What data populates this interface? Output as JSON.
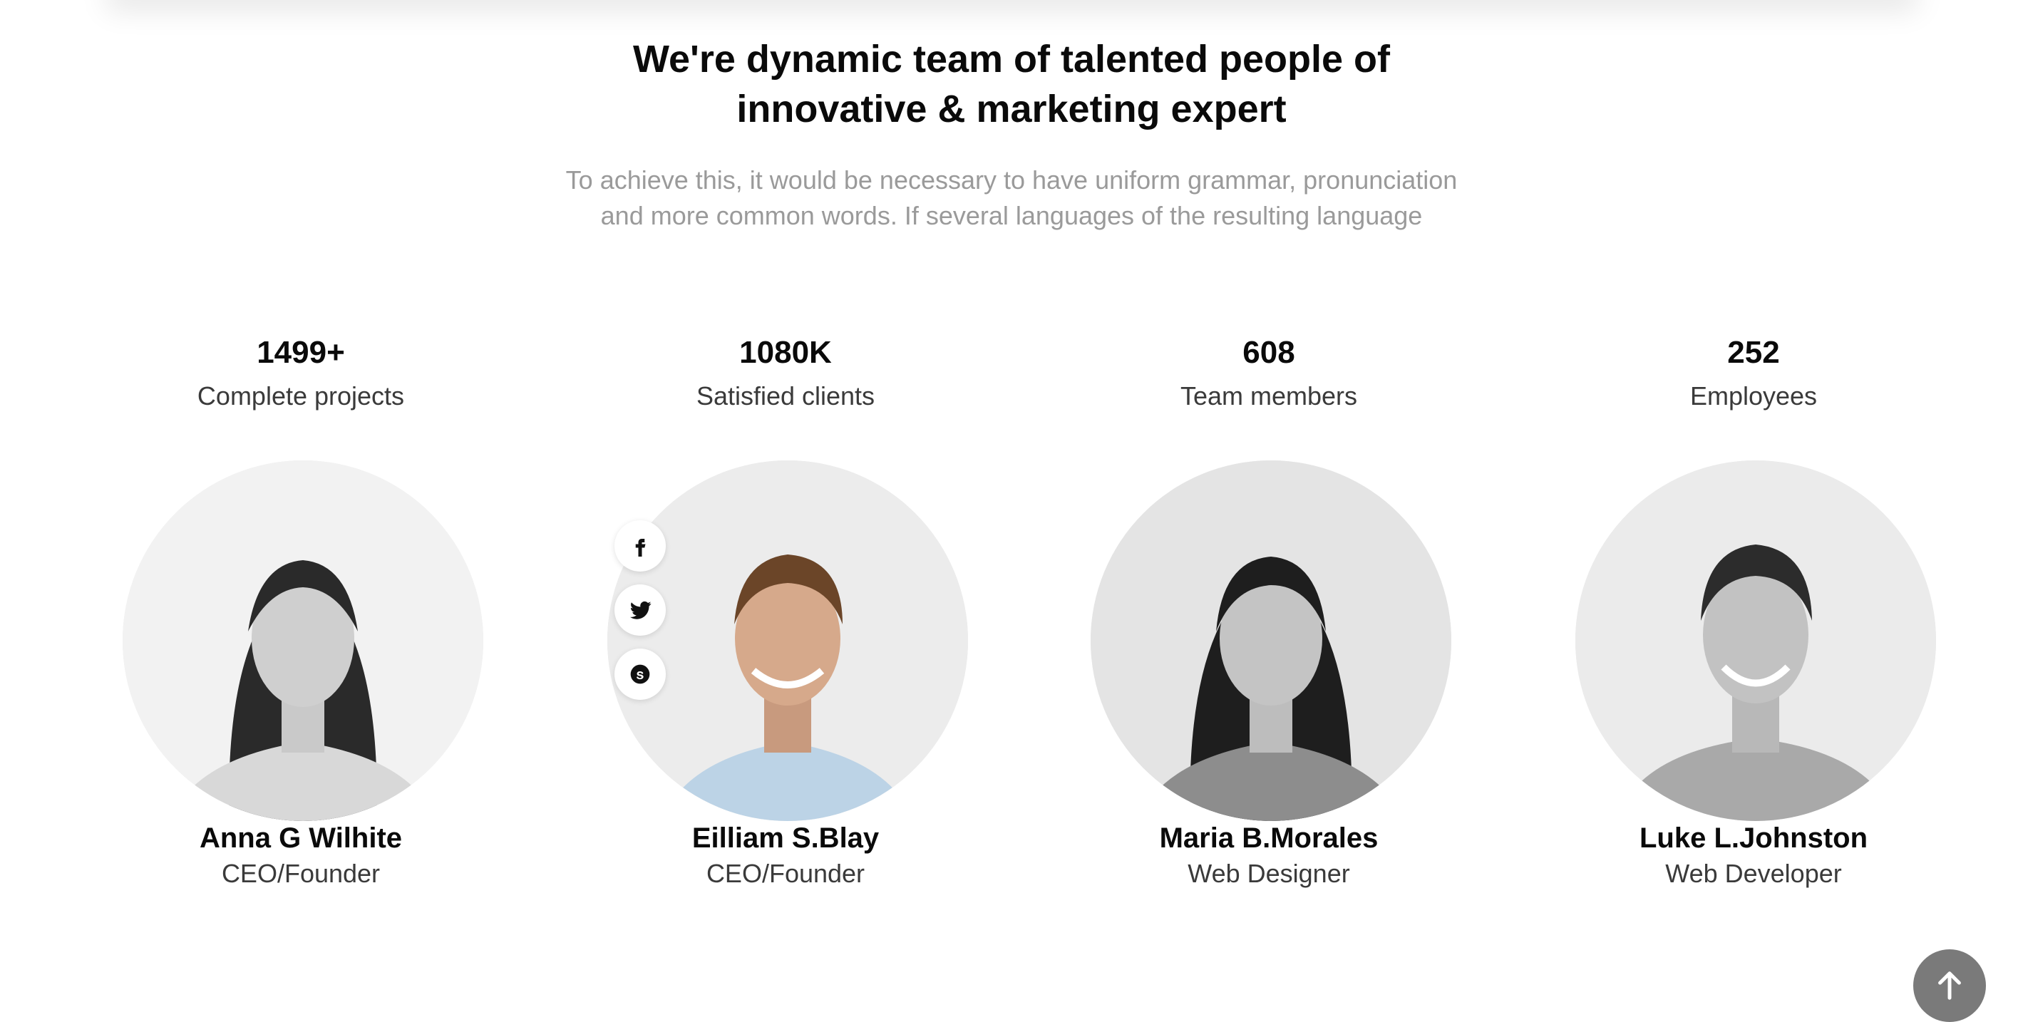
{
  "section": {
    "heading_line1": "We're dynamic team of talented people of",
    "heading_line2": "innovative & marketing expert",
    "subtext_line1": "To achieve this, it would be necessary to have uniform grammar, pronunciation",
    "subtext_line2": "and more common words. If several languages of the resulting language"
  },
  "stats": [
    {
      "value": "1499+",
      "label": "Complete projects"
    },
    {
      "value": "1080K",
      "label": "Satisfied clients"
    },
    {
      "value": "608",
      "label": "Team members"
    },
    {
      "value": "252",
      "label": "Employees"
    }
  ],
  "team": [
    {
      "name": "Anna G Wilhite",
      "role": "CEO/Founder"
    },
    {
      "name": "Eilliam S.Blay",
      "role": "CEO/Founder"
    },
    {
      "name": "Maria B.Morales",
      "role": "Web Designer"
    },
    {
      "name": "Luke L.Johnston",
      "role": "Web Developer"
    }
  ],
  "social_icons": [
    "facebook-icon",
    "twitter-icon",
    "skype-icon"
  ],
  "scroll_top_icon": "arrow-up-icon",
  "colors": {
    "heading": "#0a0a0a",
    "subtext": "#9a9a9a",
    "scroll_button": "#7a7a7a"
  }
}
